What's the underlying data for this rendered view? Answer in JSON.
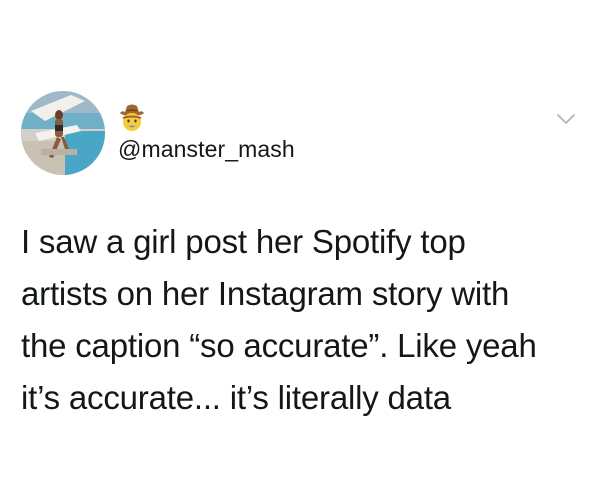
{
  "header": {
    "handle": "@manster_mash",
    "emoji_icon": "cowboy-hat-face-icon",
    "menu_icon": "chevron-down-icon"
  },
  "body": {
    "lines": [
      "I saw a girl post her Spotify top",
      "artists on her Instagram story with",
      "the caption “so accurate”. Like yeah",
      "it’s accurate... it’s literally data"
    ]
  },
  "colors": {
    "text": "#14171a",
    "chevron": "#b0b6bc",
    "background": "#ffffff"
  }
}
